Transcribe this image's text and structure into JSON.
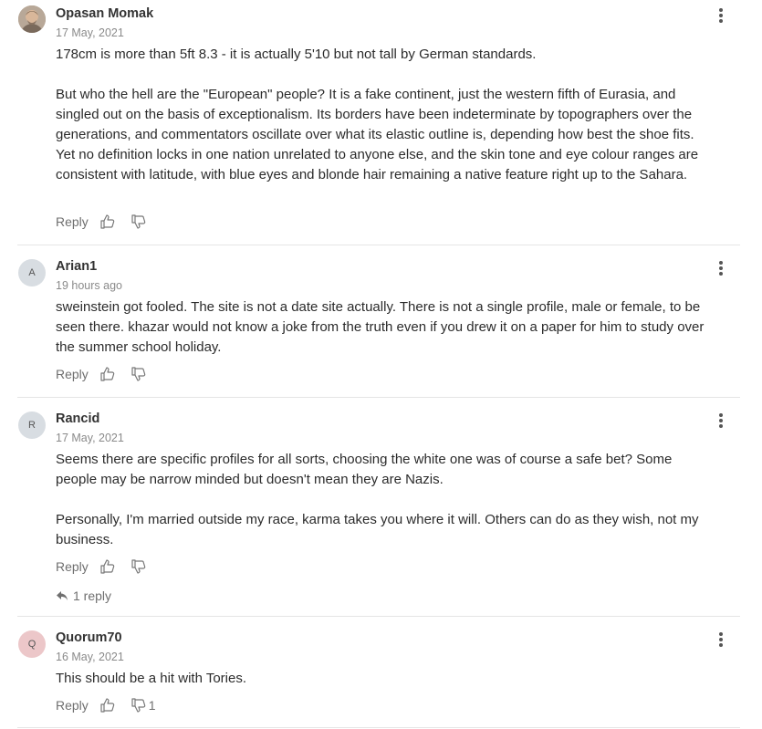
{
  "reply_label": "Reply",
  "comments": [
    {
      "author": "Opasan Momak",
      "avatar_text": "",
      "time": "17 May, 2021",
      "paragraphs": [
        "178cm is more than 5ft 8.3 - it is actually 5'10 but not tall by German standards.",
        "But who the hell are the \"European\" people? It is a fake continent, just the western fifth of Eurasia, and singled out on the basis of exceptionalism. Its borders have been indeterminate by topographers over the generations, and commentators oscillate over what its elastic outline is, depending how best the shoe fits. Yet no definition locks in one nation unrelated to anyone else, and the skin tone and eye colour ranges are consistent with latitude, with blue eyes and blonde hair remaining a native feature right up to the Sahara."
      ]
    },
    {
      "author": "Arian1",
      "avatar_text": "A",
      "time": "19 hours ago",
      "paragraphs": [
        "sweinstein got fooled. The site is not a date site actually. There is not a single profile, male or female, to be seen there. khazar would not know a joke from the truth even if you drew it on a paper for him to study over  the summer school holiday."
      ]
    },
    {
      "author": "Rancid",
      "avatar_text": "R",
      "time": "17 May, 2021",
      "paragraphs": [
        "Seems there are specific profiles for all sorts, choosing the white one was of course a safe bet? Some people may be narrow minded but doesn't mean they are Nazis.",
        "Personally, I'm married outside my race, karma takes you where it will. Others can do as they wish, not my business."
      ],
      "replies_label": "1 reply"
    },
    {
      "author": "Quorum70",
      "avatar_text": "Q",
      "time": "16 May, 2021",
      "paragraphs": [
        "This should be a hit with Tories."
      ],
      "dislike_count": "1"
    }
  ]
}
